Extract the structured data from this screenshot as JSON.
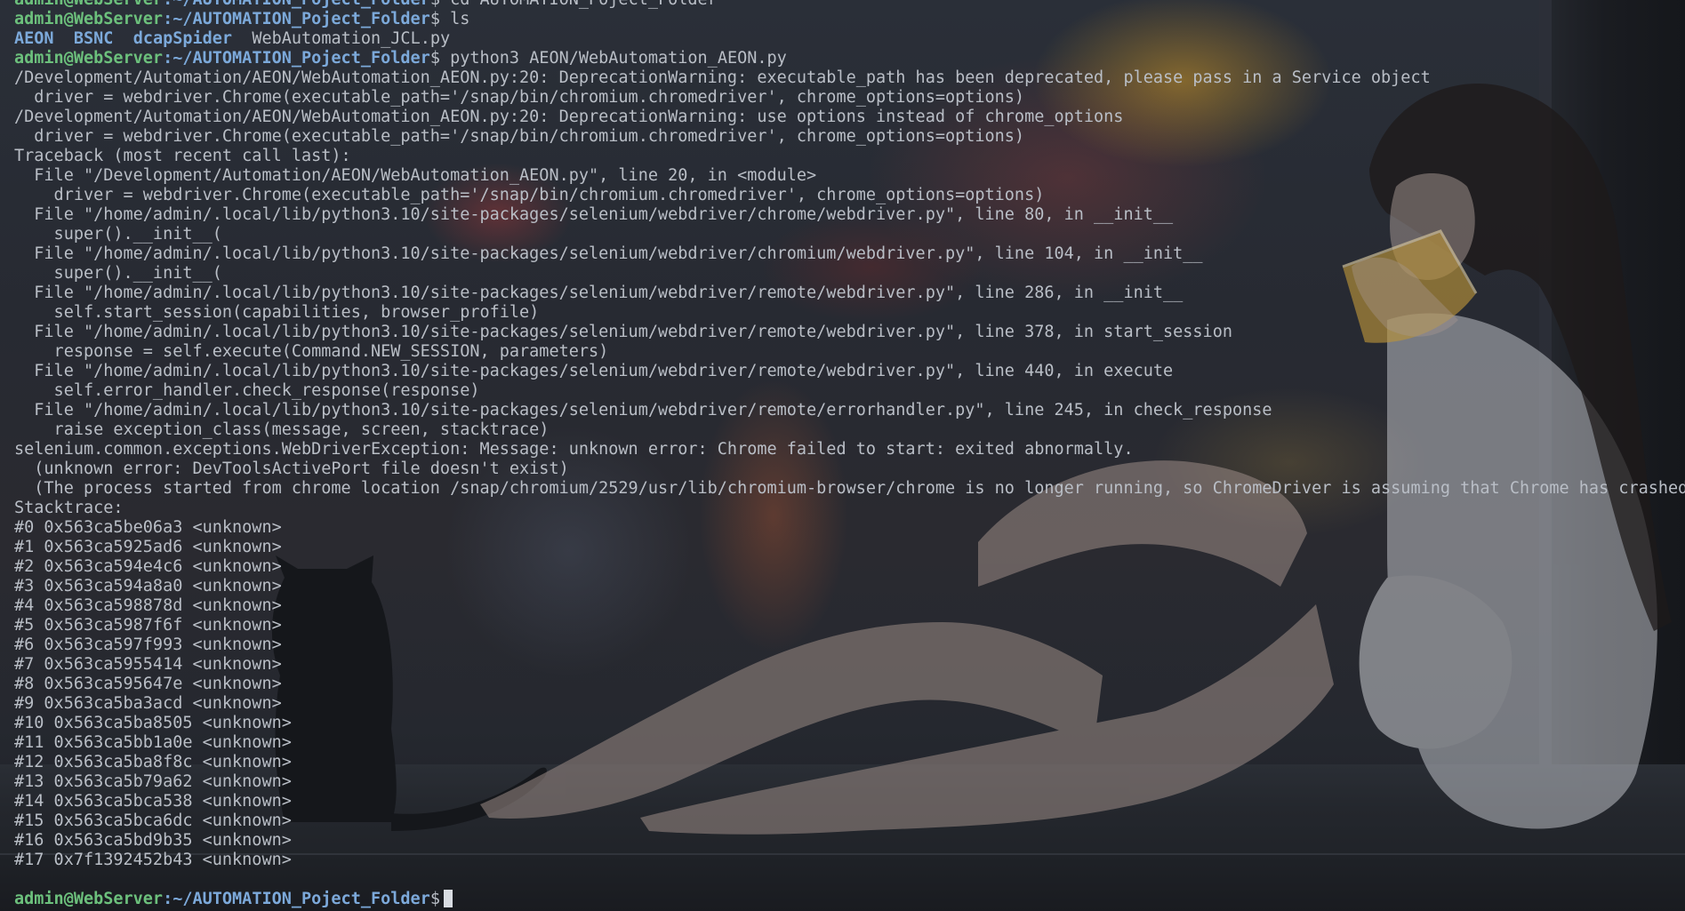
{
  "terminal": {
    "prompt": {
      "user_host": "admin@WebServer",
      "path": ":~/AUTOMATION_Poject_Folder",
      "symbol": "$"
    },
    "history": [
      {
        "type": "prompt",
        "command": " cd AUTOMATION_Poject_Folder"
      },
      {
        "type": "ls",
        "entries": [
          {
            "name": "AEON",
            "kind": "dir"
          },
          {
            "name": "BSNC",
            "kind": "dir"
          },
          {
            "name": "dcapSpider",
            "kind": "dir"
          },
          {
            "name": "WebAutomation_JCL.py",
            "kind": "file"
          }
        ]
      },
      {
        "type": "prompt",
        "command": " python3 AEON/WebAutomation_AEON.py"
      }
    ],
    "output_lines": [
      "/Development/Automation/AEON/WebAutomation_AEON.py:20: DeprecationWarning: executable_path has been deprecated, please pass in a Service object",
      "  driver = webdriver.Chrome(executable_path='/snap/bin/chromium.chromedriver', chrome_options=options)",
      "/Development/Automation/AEON/WebAutomation_AEON.py:20: DeprecationWarning: use options instead of chrome_options",
      "  driver = webdriver.Chrome(executable_path='/snap/bin/chromium.chromedriver', chrome_options=options)",
      "Traceback (most recent call last):",
      "  File \"/Development/Automation/AEON/WebAutomation_AEON.py\", line 20, in <module>",
      "    driver = webdriver.Chrome(executable_path='/snap/bin/chromium.chromedriver', chrome_options=options)",
      "  File \"/home/admin/.local/lib/python3.10/site-packages/selenium/webdriver/chrome/webdriver.py\", line 80, in __init__",
      "    super().__init__(",
      "  File \"/home/admin/.local/lib/python3.10/site-packages/selenium/webdriver/chromium/webdriver.py\", line 104, in __init__",
      "    super().__init__(",
      "  File \"/home/admin/.local/lib/python3.10/site-packages/selenium/webdriver/remote/webdriver.py\", line 286, in __init__",
      "    self.start_session(capabilities, browser_profile)",
      "  File \"/home/admin/.local/lib/python3.10/site-packages/selenium/webdriver/remote/webdriver.py\", line 378, in start_session",
      "    response = self.execute(Command.NEW_SESSION, parameters)",
      "  File \"/home/admin/.local/lib/python3.10/site-packages/selenium/webdriver/remote/webdriver.py\", line 440, in execute",
      "    self.error_handler.check_response(response)",
      "  File \"/home/admin/.local/lib/python3.10/site-packages/selenium/webdriver/remote/errorhandler.py\", line 245, in check_response",
      "    raise exception_class(message, screen, stacktrace)",
      "selenium.common.exceptions.WebDriverException: Message: unknown error: Chrome failed to start: exited abnormally.",
      "  (unknown error: DevToolsActivePort file doesn't exist)",
      "  (The process started from chrome location /snap/chromium/2529/usr/lib/chromium-browser/chrome is no longer running, so ChromeDriver is assuming that Chrome has crashed.)",
      "Stacktrace:",
      "#0 0x563ca5be06a3 <unknown>",
      "#1 0x563ca5925ad6 <unknown>",
      "#2 0x563ca594e4c6 <unknown>",
      "#3 0x563ca594a8a0 <unknown>",
      "#4 0x563ca598878d <unknown>",
      "#5 0x563ca5987f6f <unknown>",
      "#6 0x563ca597f993 <unknown>",
      "#7 0x563ca5955414 <unknown>",
      "#8 0x563ca595647e <unknown>",
      "#9 0x563ca5ba3acd <unknown>",
      "#10 0x563ca5ba8505 <unknown>",
      "#11 0x563ca5bb1a0e <unknown>",
      "#12 0x563ca5ba8f8c <unknown>",
      "#13 0x563ca5b79a62 <unknown>",
      "#14 0x563ca5bca538 <unknown>",
      "#15 0x563ca5bca6dc <unknown>",
      "#16 0x563ca5bd9b35 <unknown>",
      "#17 0x7f1392452b43 <unknown>"
    ],
    "current_input": "",
    "colors": {
      "user_host": "#6cc07c",
      "path": "#7ca9da",
      "directory": "#7ca9da",
      "text": "#b9bec6",
      "cursor": "#d8dce2"
    },
    "wallpaper": "anime-girl-by-rainy-window-with-cat"
  }
}
